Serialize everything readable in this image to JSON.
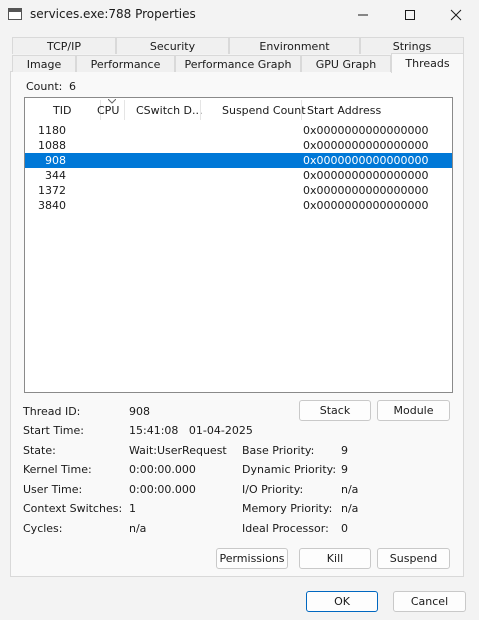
{
  "window": {
    "title": "services.exe:788 Properties"
  },
  "tabs_row1": [
    "TCP/IP",
    "Security",
    "Environment",
    "Strings"
  ],
  "tabs_row2": [
    "Image",
    "Performance",
    "Performance Graph",
    "GPU Graph",
    "Threads"
  ],
  "active_tab": "Threads",
  "count": {
    "label": "Count:",
    "value": "6"
  },
  "columns": [
    "TID",
    "CPU",
    "CSwitch D...",
    "Suspend Count",
    "Start Address"
  ],
  "threads": [
    {
      "tid": "1180",
      "start": "0x0000000000000000"
    },
    {
      "tid": "1088",
      "start": "0x0000000000000000"
    },
    {
      "tid": "908",
      "start": "0x0000000000000000",
      "selected": true
    },
    {
      "tid": "344",
      "start": "0x0000000000000000"
    },
    {
      "tid": "1372",
      "start": "0x0000000000000000"
    },
    {
      "tid": "3840",
      "start": "0x0000000000000000"
    }
  ],
  "details": {
    "thread_id": {
      "label": "Thread ID:",
      "value": "908"
    },
    "start_time": {
      "label": "Start Time:",
      "value": "15:41:08   01-04-2025"
    },
    "state": {
      "label": "State:",
      "value": "Wait:UserRequest"
    },
    "kernel_time": {
      "label": "Kernel Time:",
      "value": "0:00:00.000"
    },
    "user_time": {
      "label": "User Time:",
      "value": "0:00:00.000"
    },
    "context_switches": {
      "label": "Context Switches:",
      "value": "1"
    },
    "cycles": {
      "label": "Cycles:",
      "value": "n/a"
    },
    "base_priority": {
      "label": "Base Priority:",
      "value": "9"
    },
    "dynamic_priority": {
      "label": "Dynamic Priority:",
      "value": "9"
    },
    "io_priority": {
      "label": "I/O Priority:",
      "value": "n/a"
    },
    "memory_priority": {
      "label": "Memory Priority:",
      "value": "n/a"
    },
    "ideal_processor": {
      "label": "Ideal Processor:",
      "value": "0"
    }
  },
  "buttons": {
    "stack": "Stack",
    "module": "Module",
    "permissions": "Permissions",
    "kill": "Kill",
    "suspend": "Suspend",
    "ok": "OK",
    "cancel": "Cancel"
  },
  "colors": {
    "selection": "#0078d7",
    "accent": "#0067c0"
  }
}
